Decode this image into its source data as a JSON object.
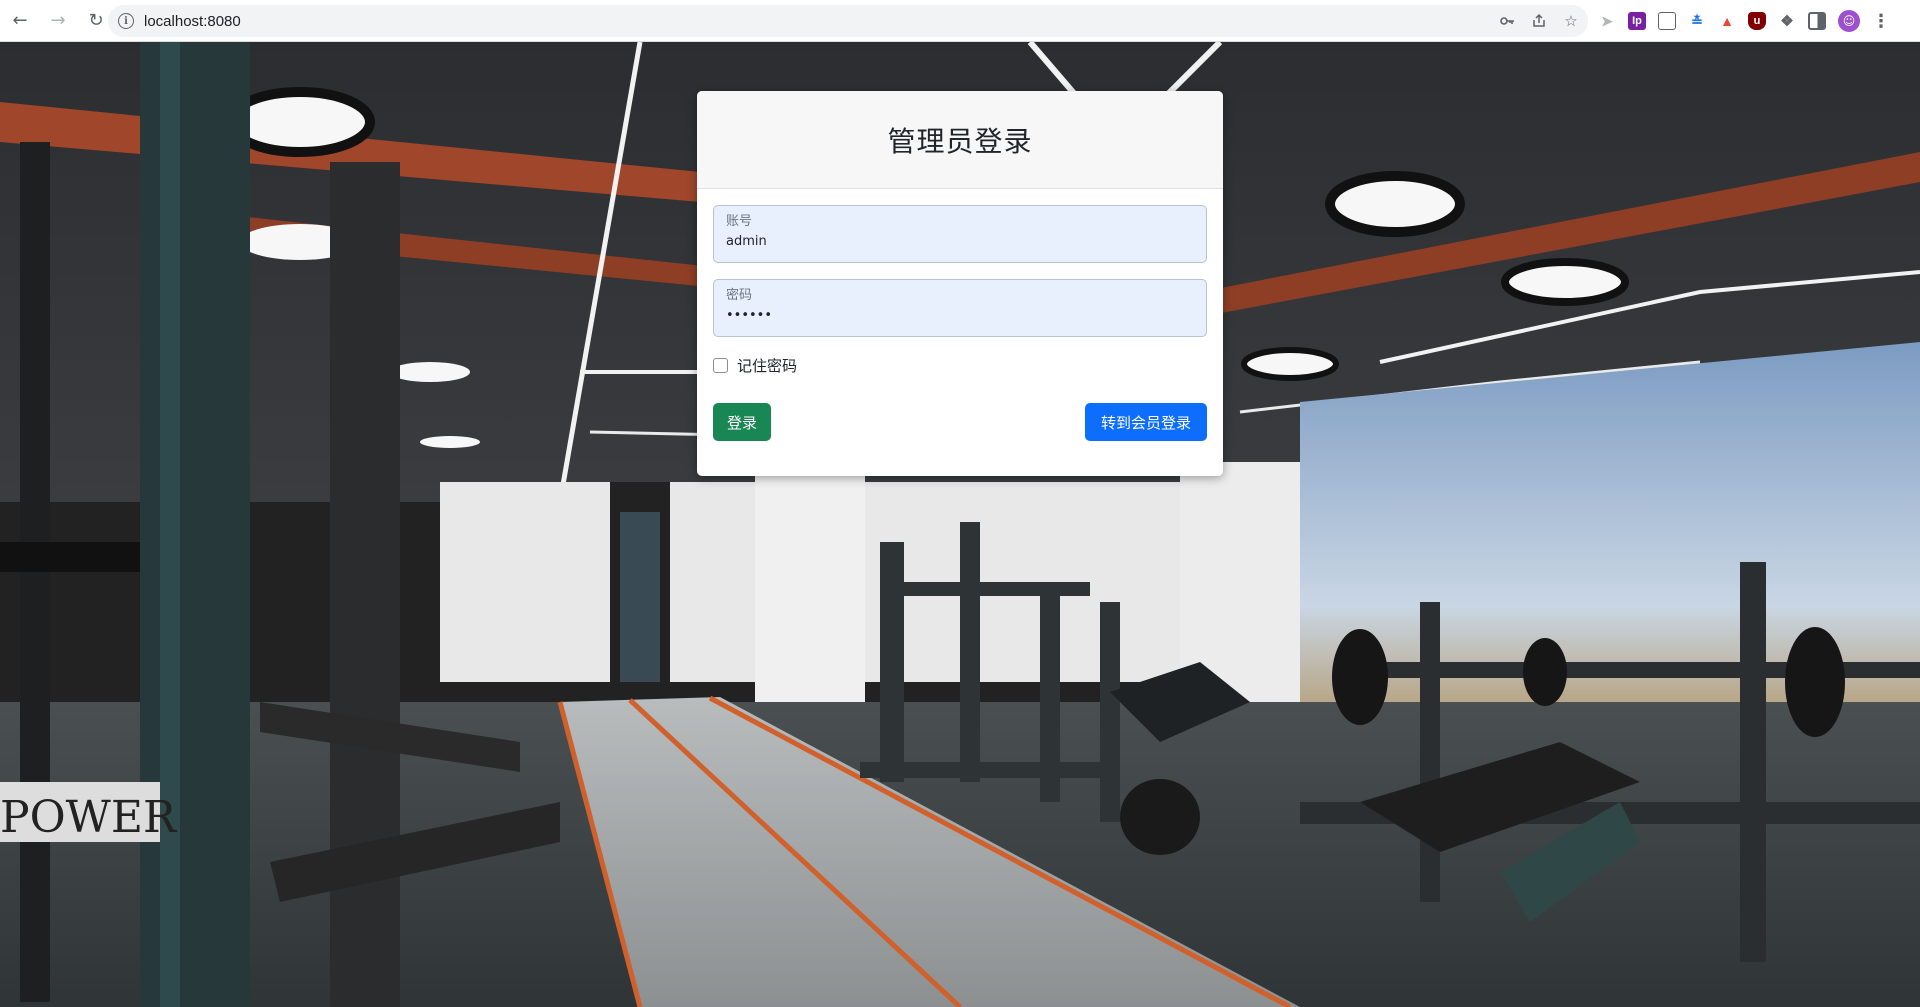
{
  "browser": {
    "url": "localhost:8080",
    "nav": {
      "back_icon": "back-arrow-icon",
      "forward_icon": "forward-arrow-icon",
      "reload_icon": "reload-icon"
    },
    "omnibox_icons": [
      "key-icon",
      "share-icon",
      "star-icon"
    ],
    "extensions": [
      {
        "name": "cursor-ext-icon",
        "color": "#b0b3b8"
      },
      {
        "name": "ext-purple-icon",
        "color": "#7b1fa2"
      },
      {
        "name": "ext-grid-icon",
        "color": "#5f6368"
      },
      {
        "name": "ext-blue-chevron-icon",
        "color": "#1a73e8"
      },
      {
        "name": "ext-red-a-icon",
        "color": "#e8453c"
      },
      {
        "name": "ublock-icon",
        "color": "#800000"
      },
      {
        "name": "puzzle-icon",
        "color": "#5f6368"
      },
      {
        "name": "side-panel-icon",
        "color": "#5f6368"
      }
    ]
  },
  "login": {
    "title": "管理员登录",
    "account_label": "账号",
    "account_value": "admin",
    "password_label": "密码",
    "password_value": "••••••",
    "remember_label": "记住密码",
    "login_button": "登录",
    "switch_button": "转到会员登录"
  },
  "colors": {
    "success": "#198754",
    "primary": "#0d6efd",
    "field_bg": "#e8f0fe"
  }
}
